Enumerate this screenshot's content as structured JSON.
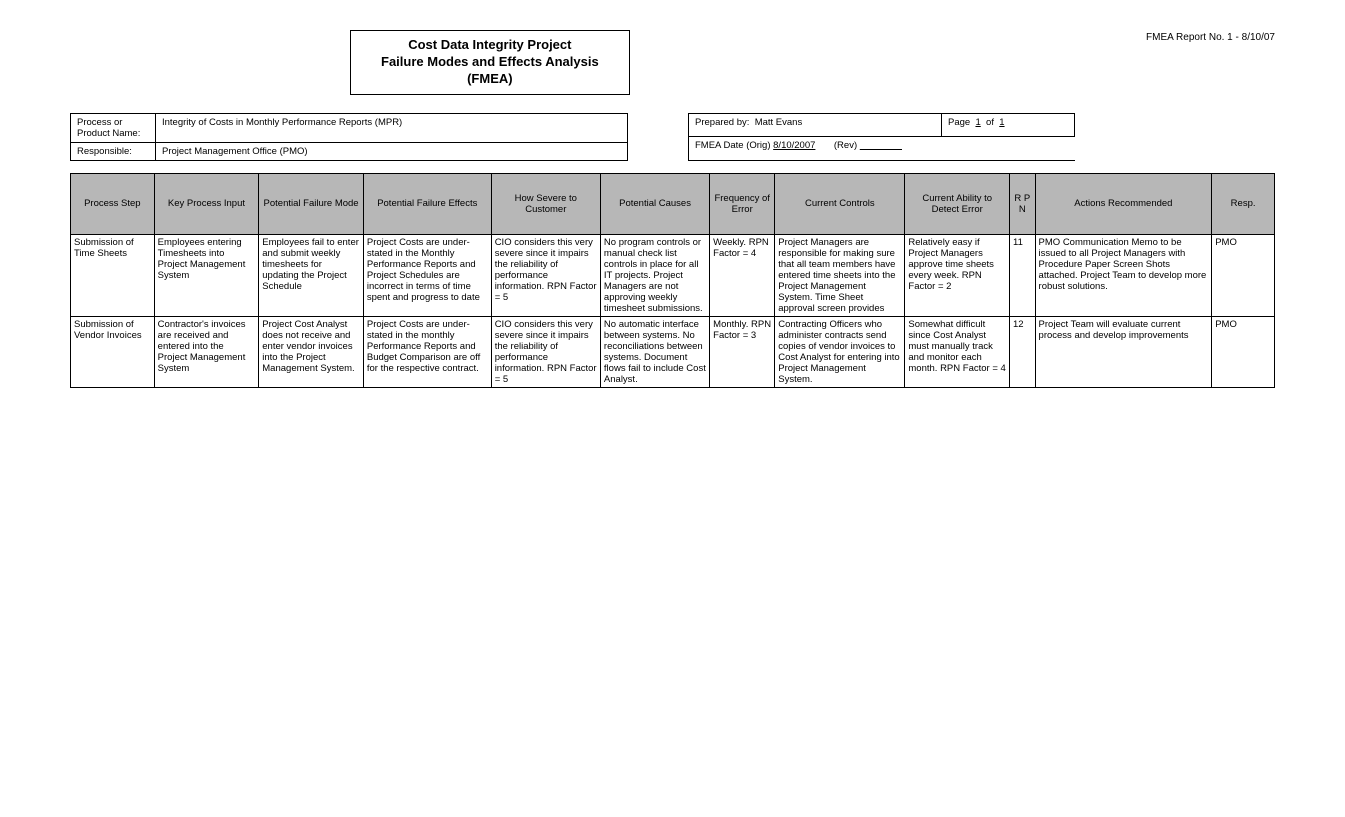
{
  "header": {
    "title_line1": "Cost Data Integrity Project",
    "title_line2": "Failure Modes and Effects Analysis",
    "title_line3": "(FMEA)",
    "report_no": "FMEA Report No. 1 - 8/10/07"
  },
  "meta": {
    "process_label": "Process or Product Name:",
    "process_value": "Integrity of Costs in Monthly Performance Reports (MPR)",
    "responsible_label": "Responsible:",
    "responsible_value": "Project Management Office (PMO)",
    "prepared_label": "Prepared by:",
    "prepared_value": "Matt Evans",
    "page_label": "Page",
    "page_num": "1",
    "page_of": "of",
    "page_total": "1",
    "date_label": "FMEA Date (Orig)",
    "date_value": "8/10/2007",
    "rev_label": "(Rev)",
    "rev_value": ""
  },
  "columns": {
    "step": "Process Step",
    "input": "Key Process Input",
    "mode": "Potential Failure Mode",
    "effects": "Potential Failure Effects",
    "severity": "How Severe to Customer",
    "causes": "Potential Causes",
    "frequency": "Frequency of Error",
    "controls": "Current Controls",
    "detect": "Current Ability to Detect Error",
    "rpn": "R P N",
    "actions": "Actions Recommended",
    "resp": "Resp."
  },
  "rows": [
    {
      "step": "Submission of Time Sheets",
      "input": "Employees entering Timesheets into Project Management System",
      "mode": "Employees fail to enter and submit weekly timesheets for updating the Project Schedule",
      "effects": "Project Costs are under-stated in the Monthly Performance Reports and Project Schedules are incorrect in terms of time spent and progress to date",
      "severity": "CIO considers this very severe since it impairs the reliability of performance information. RPN Factor = 5",
      "causes": "No program controls or manual check list controls in place for all IT projects. Project Managers are not approving weekly timesheet submissions.",
      "frequency": "Weekly. RPN Factor = 4",
      "controls": "Project Managers are responsible for making sure that all team members have entered time sheets into the Project Management System. Time Sheet approval screen provides",
      "detect": "Relatively easy if Project Managers approve time sheets every week. RPN Factor = 2",
      "rpn": "11",
      "actions": "PMO Communication Memo to be issued to all Project Managers with Procedure Paper Screen Shots attached. Project Team to develop more robust solutions.",
      "resp": "PMO"
    },
    {
      "step": "Submission of Vendor Invoices",
      "input": "Contractor's invoices are received and entered into the Project Management System",
      "mode": "Project Cost Analyst does not receive and enter vendor invoices into the Project Management System.",
      "effects": "Project Costs are under-stated in the monthly Performance Reports and Budget Comparison are off for the respective contract.",
      "severity": "CIO considers this very severe since it impairs the reliability of performance information. RPN Factor = 5",
      "causes": "No automatic interface between systems. No reconciliations between systems. Document flows fail to include Cost Analyst.",
      "frequency": "Monthly. RPN Factor = 3",
      "controls": "Contracting Officers who administer contracts send copies of vendor invoices to Cost Analyst for entering into Project Management System.",
      "detect": "Somewhat difficult since Cost Analyst must manually track and monitor each month. RPN Factor = 4",
      "rpn": "12",
      "actions": "Project Team will evaluate current process and develop improvements",
      "resp": "PMO"
    }
  ]
}
